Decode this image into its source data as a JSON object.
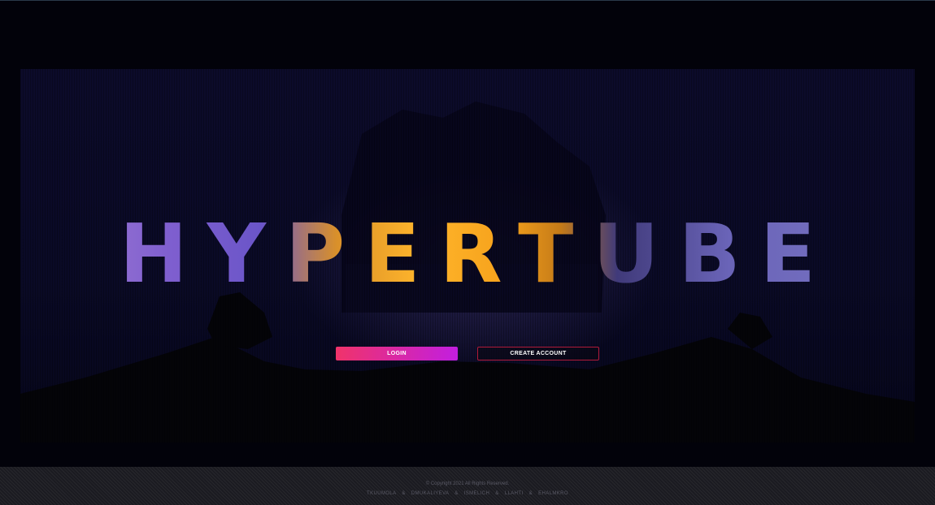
{
  "app": {
    "title": "HYPERTUBE"
  },
  "actions": {
    "login_label": "LOGIN",
    "create_account_label": "CREATE ACCOUNT"
  },
  "footer": {
    "copyright": "© Copyright 2021 All Rights Reserved.",
    "authors": [
      "TKUUMOLA",
      "DMUKALIYEVA",
      "ISMELICH",
      "LLAHTI",
      "EHALMKRO"
    ],
    "separator": "&"
  },
  "colors": {
    "login_gradient_start": "#f0336a",
    "login_gradient_end": "#c21ee0",
    "create_account_border": "#b01a3a",
    "footer_text": "#5a5a66"
  }
}
